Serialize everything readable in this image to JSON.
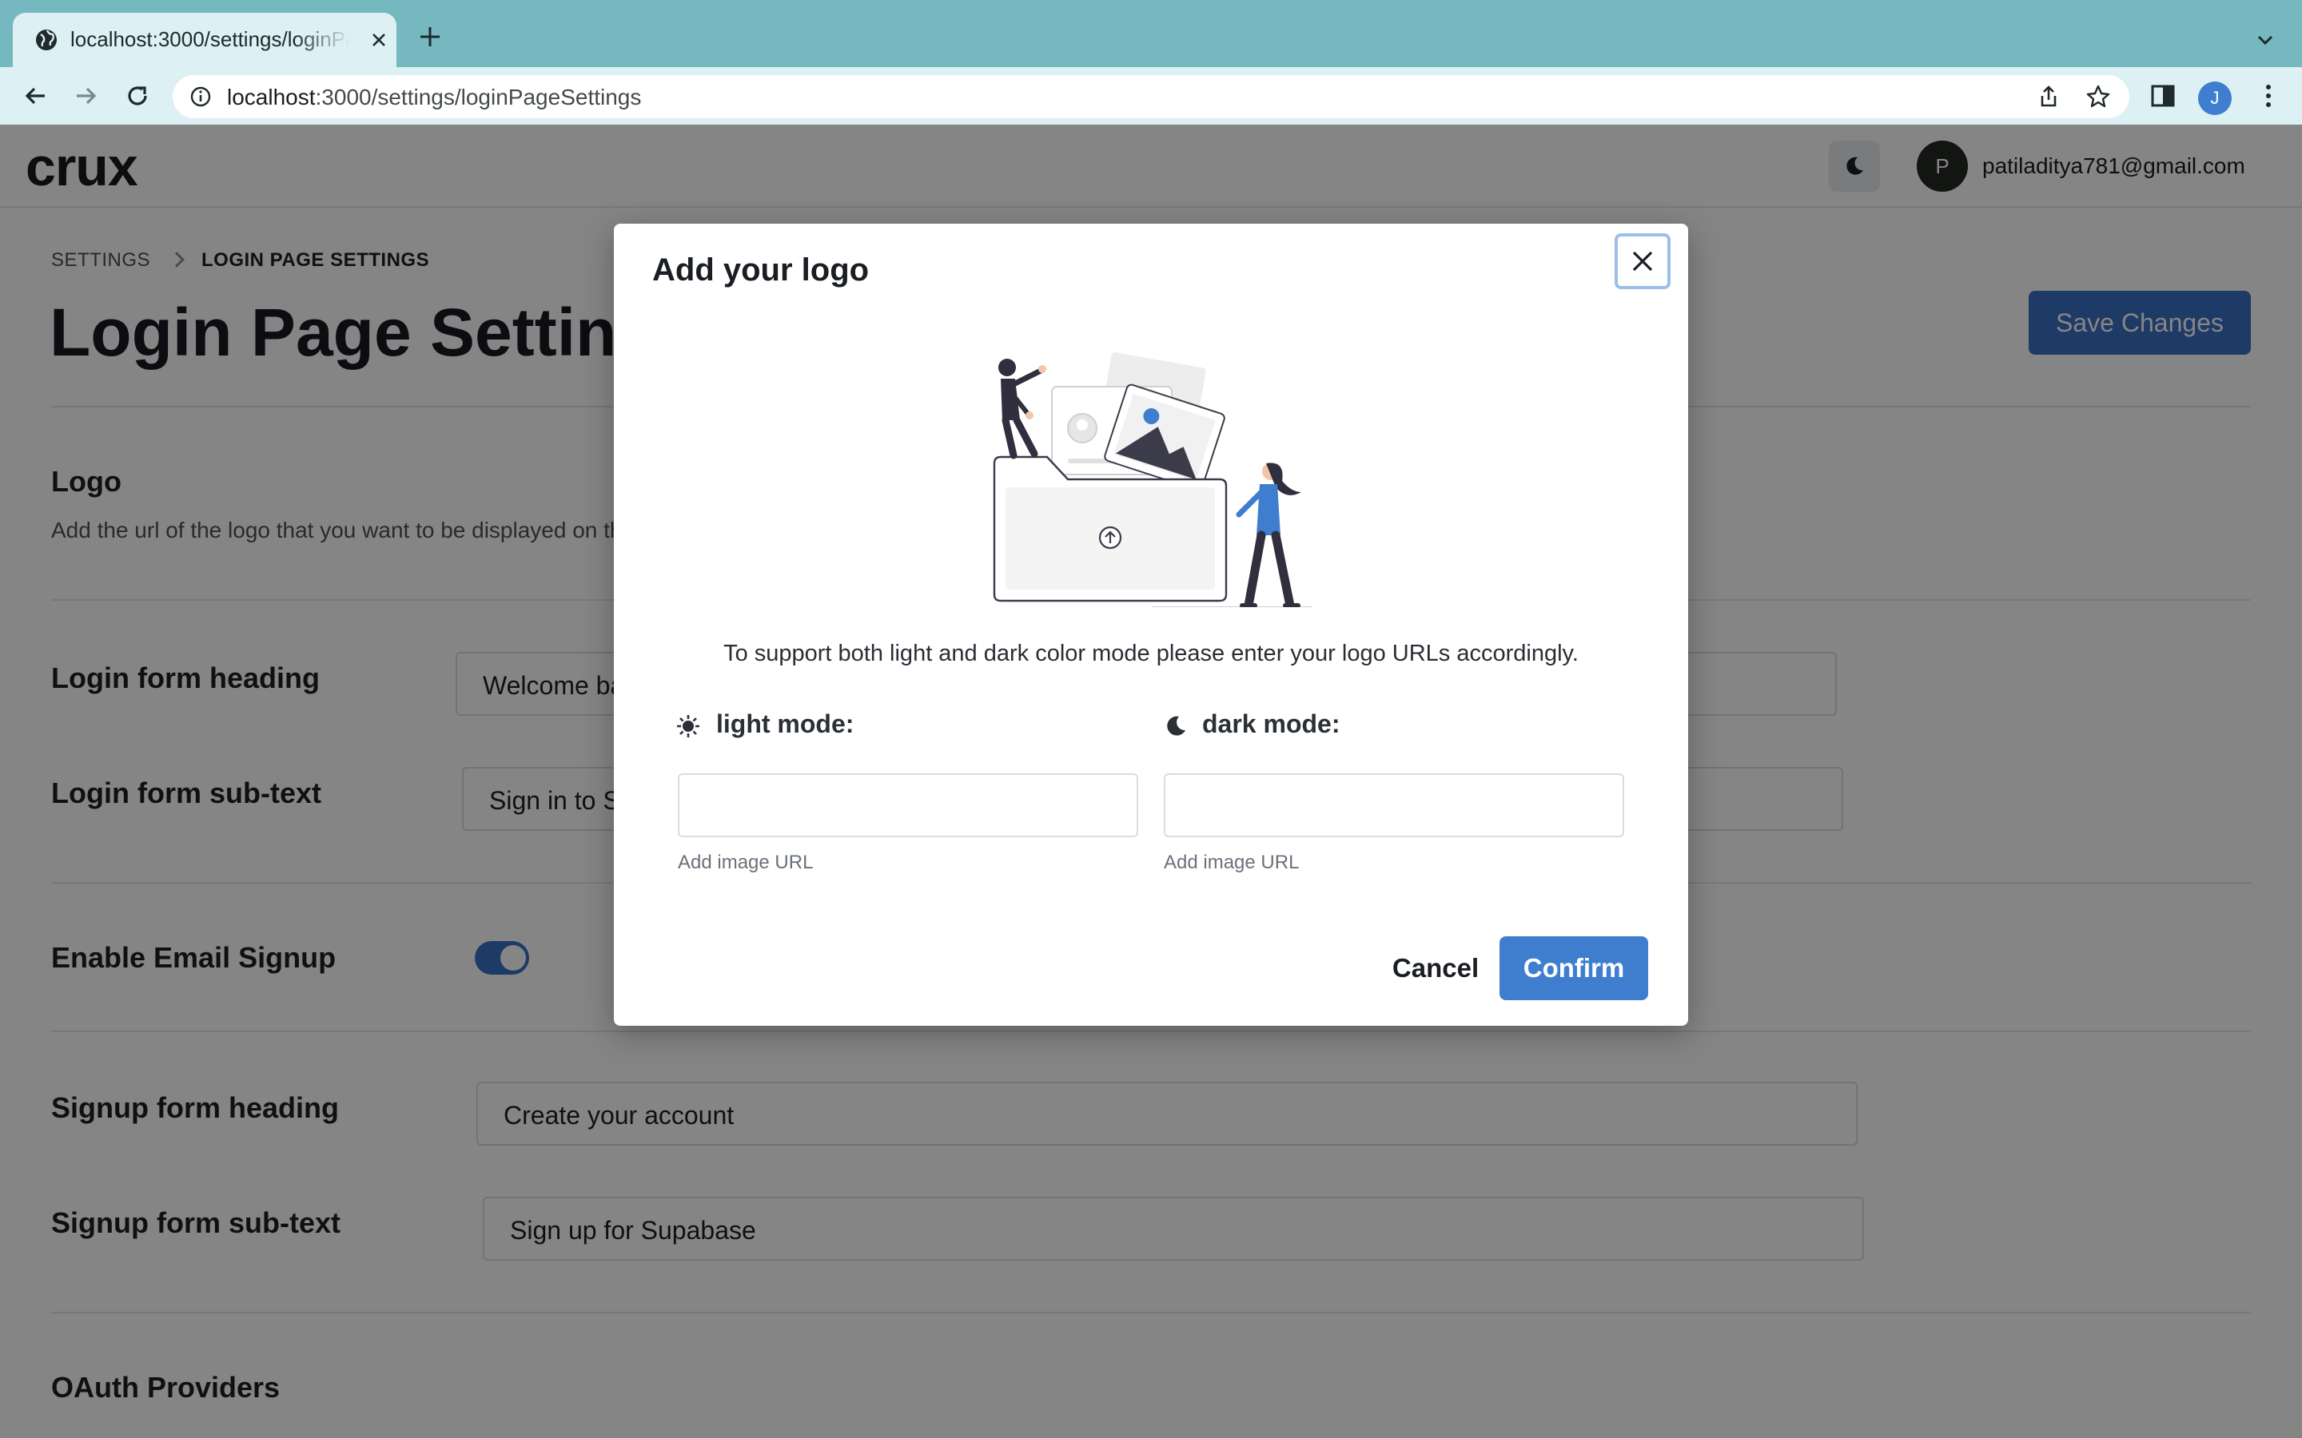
{
  "browser": {
    "tab_title": "localhost:3000/settings/loginPageSettings",
    "url_host": "localhost",
    "url_path": ":3000/settings/loginPageSettings",
    "profile_initial": "J",
    "icons": [
      "globe-icon",
      "close-icon",
      "plus-icon",
      "chevron-down-icon",
      "back-icon",
      "forward-icon",
      "reload-icon",
      "info-icon",
      "share-icon",
      "star-icon",
      "sidebar-icon",
      "kebab-menu-icon"
    ]
  },
  "app": {
    "brand": "crux",
    "user_initial": "P",
    "user_email": "patiladitya781@gmail.com"
  },
  "breadcrumb": {
    "root": "SETTINGS",
    "current": "LOGIN PAGE SETTINGS"
  },
  "page": {
    "title": "Login Page Settings",
    "save_label": "Save Changes"
  },
  "sections": {
    "logo": {
      "heading": "Logo",
      "description": "Add the url of the logo that you want to be displayed on the login page"
    },
    "login_heading": {
      "label": "Login form heading",
      "value": "Welcome back"
    },
    "login_subtext": {
      "label": "Login form sub-text",
      "value": "Sign in to Supabase"
    },
    "email_signup": {
      "label": "Enable Email Signup",
      "enabled": true
    },
    "signup_heading": {
      "label": "Signup form heading",
      "value": "Create your account"
    },
    "signup_subtext": {
      "label": "Signup form sub-text",
      "value": "Sign up for Supabase"
    },
    "oauth": {
      "heading": "OAuth Providers"
    }
  },
  "modal": {
    "title": "Add your logo",
    "description": "To support both light and dark color mode please enter your logo URLs accordingly.",
    "light": {
      "label": "light mode:",
      "value": "",
      "helper": "Add image URL"
    },
    "dark": {
      "label": "dark mode:",
      "value": "",
      "helper": "Add image URL"
    },
    "cancel_label": "Cancel",
    "confirm_label": "Confirm"
  },
  "colors": {
    "tabstrip": "#75b8c0",
    "toolbar": "#ddf0f3",
    "primary": "#3a6fc4",
    "confirm": "#3f7ecf"
  }
}
